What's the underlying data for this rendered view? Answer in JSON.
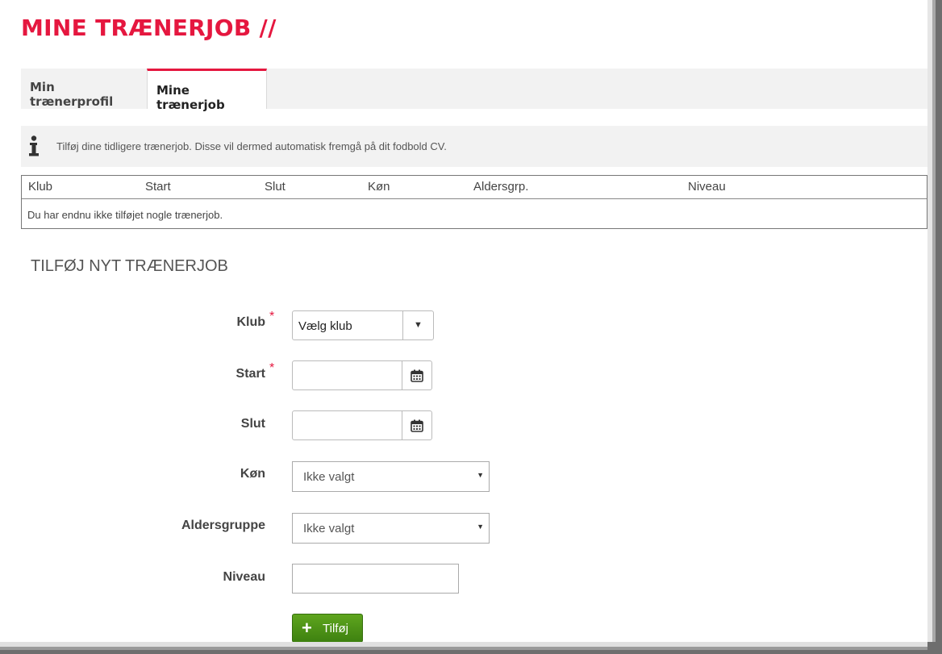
{
  "page": {
    "title": "MINE TRÆNERJOB //"
  },
  "tabs": [
    {
      "label": "Min trænerprofil",
      "active": false
    },
    {
      "label": "Mine trænerjob",
      "active": true
    }
  ],
  "info": {
    "icon": "info-icon",
    "text": "Tilføj dine tidligere trænerjob. Disse vil dermed automatisk fremgå på dit fodbold CV."
  },
  "jobs_table": {
    "columns": [
      "Klub",
      "Start",
      "Slut",
      "Køn",
      "Aldersgrp.",
      "Niveau"
    ],
    "empty_message": "Du har endnu ikke tilføjet nogle trænerjob."
  },
  "form": {
    "section_title": "TILFØJ NYT TRÆNERJOB",
    "required_mark": "*",
    "klub": {
      "label": "Klub",
      "value": "Vælg klub",
      "required": true
    },
    "start": {
      "label": "Start",
      "value": "",
      "required": true
    },
    "slut": {
      "label": "Slut",
      "value": "",
      "required": false
    },
    "kon": {
      "label": "Køn",
      "value": "Ikke valgt"
    },
    "aldersgruppe": {
      "label": "Aldersgruppe",
      "value": "Ikke valgt"
    },
    "niveau": {
      "label": "Niveau",
      "value": ""
    },
    "submit_label": "Tilføj",
    "submit_icon": "plus-icon"
  },
  "colors": {
    "accent": "#e5173f",
    "button_green": "#4a8f16",
    "panel_gray": "#f2f2f2"
  }
}
